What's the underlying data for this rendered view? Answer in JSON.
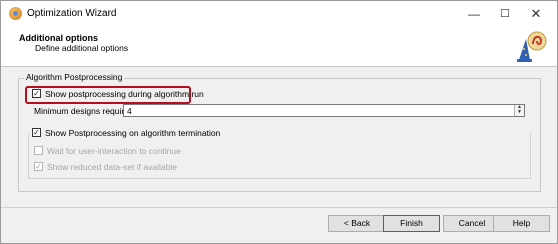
{
  "window": {
    "title": "Optimization Wizard"
  },
  "window_controls": {
    "minimize": "—",
    "maximize": "☐",
    "close": "✕"
  },
  "header": {
    "title": "Additional options",
    "subtitle": "Define additional options"
  },
  "group": {
    "label": "Algorithm Postprocessing"
  },
  "options": {
    "show_during_run": {
      "label": "Show postprocessing during algorithm run",
      "checked": true,
      "mark": "✓"
    },
    "min_designs": {
      "label": "Minimum designs required:",
      "value": "4",
      "up": "▲",
      "down": "▼"
    },
    "show_on_termination": {
      "label": "Show Postprocessing on algorithm termination",
      "checked": true,
      "mark": "✓"
    },
    "wait_user": {
      "label": "Wait for user-interaction to continue",
      "checked": false,
      "enabled": false,
      "mark": ""
    },
    "show_reduced": {
      "label": "Show reduced data-set if available",
      "checked": true,
      "enabled": false,
      "mark": "✓"
    }
  },
  "buttons": {
    "back": "< Back",
    "finish": "Finish",
    "cancel": "Cancel",
    "help": "Help"
  },
  "colors": {
    "highlight": "#b40f1e",
    "default_button_border": "#0078d7"
  }
}
